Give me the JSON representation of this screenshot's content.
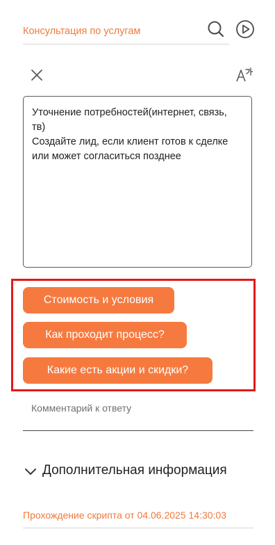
{
  "header": {
    "select_value": "Консультация по услугам",
    "search_icon": "search-icon",
    "play_icon": "play-circle-icon"
  },
  "toolbar": {
    "close_icon": "close-icon",
    "translate_icon": "translate-icon"
  },
  "script": {
    "line1": "Уточнение потребностей(интернет, связь,",
    "line2": "тв)",
    "line3": "Создайте лид, если клиент готов к сделке",
    "line4": "или может согласиться позднее"
  },
  "answers": [
    {
      "label": "Стоимость и условия"
    },
    {
      "label": "Как проходит процесс?"
    },
    {
      "label": "Какие есть акции и скидки?"
    }
  ],
  "comment": {
    "placeholder": "Комментарий к ответу"
  },
  "extra_info": {
    "label": "Дополнительная информация"
  },
  "footer": {
    "text": "Прохождение скрипта от 04.06.2025 14:30:03"
  },
  "colors": {
    "accent": "#f67a3f",
    "highlight": "#e11919"
  }
}
